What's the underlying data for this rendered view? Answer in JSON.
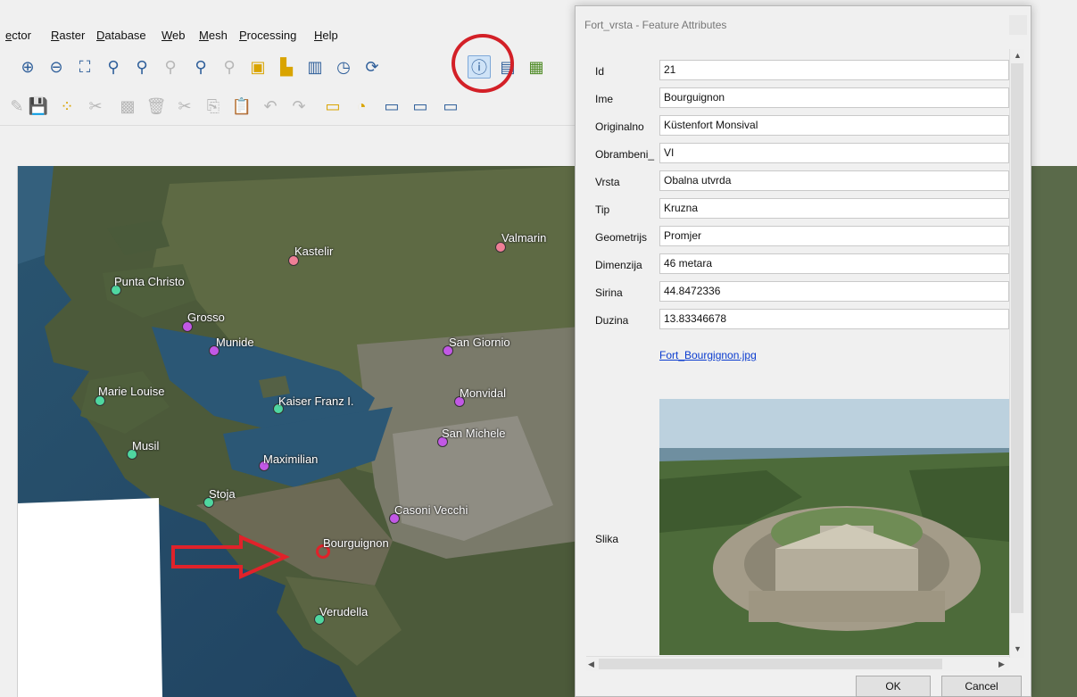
{
  "menu": [
    "ector",
    "Raster",
    "Database",
    "Web",
    "Mesh",
    "Processing",
    "Help"
  ],
  "map": {
    "places": [
      {
        "name": "Kastelir",
        "color": "pink"
      },
      {
        "name": "Valmarin",
        "color": "pink"
      },
      {
        "name": "Punta Christo",
        "color": "teal"
      },
      {
        "name": "Grosso",
        "color": "purple"
      },
      {
        "name": "Munide",
        "color": "purple"
      },
      {
        "name": "San Giornio",
        "color": "purple"
      },
      {
        "name": "Marie Louise",
        "color": "teal"
      },
      {
        "name": "Kaiser Franz I.",
        "color": "teal"
      },
      {
        "name": "Monvidal",
        "color": "purple"
      },
      {
        "name": "Musil",
        "color": "teal"
      },
      {
        "name": "San Michele",
        "color": "purple"
      },
      {
        "name": "Maximilian",
        "color": "purple"
      },
      {
        "name": "Stoja",
        "color": "teal"
      },
      {
        "name": "Casoni Vecchi",
        "color": "purple"
      },
      {
        "name": "Bourguignon",
        "color": "red"
      },
      {
        "name": "Verudella",
        "color": "teal"
      }
    ]
  },
  "dialog": {
    "title": "Fort_vrsta - Feature Attributes",
    "fields": [
      {
        "label": "Id",
        "value": "21"
      },
      {
        "label": "Ime",
        "value": "Bourguignon"
      },
      {
        "label": "Originalno",
        "value": "Küstenfort Monsival"
      },
      {
        "label": "Obrambeni_",
        "value": "VI"
      },
      {
        "label": "Vrsta",
        "value": "Obalna utvrda"
      },
      {
        "label": "Tip",
        "value": "Kruzna"
      },
      {
        "label": "Geometrijs",
        "value": "Promjer"
      },
      {
        "label": "Dimenzija",
        "value": "46 metara"
      },
      {
        "label": "Sirina",
        "value": "44.8472336"
      },
      {
        "label": "Duzina",
        "value": "13.83346678"
      }
    ],
    "link": "Fort_Bourgignon.jpg",
    "image_label": "Slika",
    "ok": "OK",
    "cancel": "Cancel"
  }
}
